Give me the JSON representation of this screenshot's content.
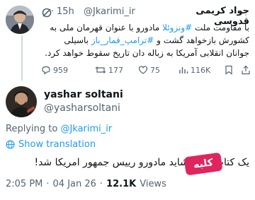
{
  "parent_tweet": {
    "display_name": "جواد کریمی قدوسی",
    "handle": "@Jkarimi_ir",
    "separator": "·",
    "time_ago": "15h",
    "text_line1_a": "با مقاومت ملت ",
    "text_line1_tag": "#ونزوئلا",
    "text_line1_b": " مادورو با عنوان قهرمان ملی به",
    "text_line2_a": "کشورش بازخواهد گشت و ",
    "text_line2_tag": "#ترامپ_قمار_باز",
    "text_line2_b": " باسیلی",
    "text_line3": "جوانان انقلابی آمریکا به زباله دان تاریخ سقوط خواهد کرد.",
    "stats": {
      "replies": "959",
      "retweets": "177",
      "likes": "75",
      "views": "116K"
    }
  },
  "reply_tweet": {
    "display_name": "yashar soltani",
    "handle": "@yasharsoltani",
    "replying_to_prefix": "Replying to ",
    "replying_to_handle": "@Jkarimi_ir",
    "show_translation": "Show translation",
    "text": "یک کتاب بگیر؛ شاید مادورو رییس جمهور امریکا شد!",
    "watermark": "کلبه",
    "time": "2:05 PM",
    "date": "04 Jan 26",
    "dot": "·",
    "views_count": "12.1K",
    "views_label": "Views"
  },
  "colors": {
    "accent": "#1d9bf0",
    "muted": "#536471",
    "watermark": "#e0245e"
  }
}
